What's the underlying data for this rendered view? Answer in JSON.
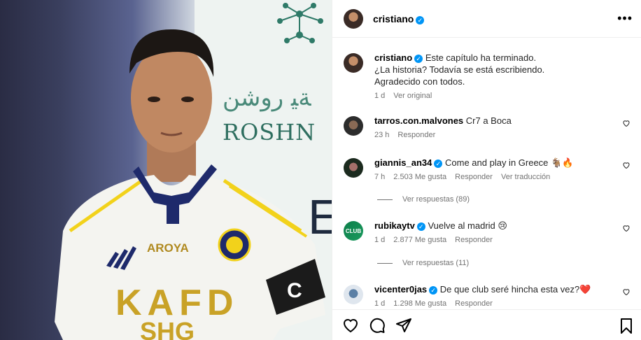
{
  "post": {
    "username": "cristiano",
    "more_icon": "more-horizontal-icon",
    "caption": {
      "username": "cristiano",
      "lines": [
        "Este capítulo ha terminado.",
        "¿La historia? Todavía se está escribiendo.",
        "Agradecido con todos."
      ],
      "time": "1 d",
      "see_original": "Ver original"
    },
    "photo": {
      "roshn_ar": "ﺔﻴ روشن",
      "roshn": "ROSHN",
      "shirt_brand": "AROYA",
      "shirt_sponsor": "KAFD",
      "shirt_bottom": "SHG"
    }
  },
  "comments": [
    {
      "user": "tarros.con.malvones",
      "verified": false,
      "text": "Cr7 a Boca",
      "time": "23 h",
      "likes": "",
      "reply": "Responder",
      "translate": ""
    },
    {
      "user": "giannis_an34",
      "verified": true,
      "text": "Come and play in Greece 🐐🔥",
      "time": "7 h",
      "likes": "2.503 Me gusta",
      "reply": "Responder",
      "translate": "Ver traducción",
      "replies": "Ver respuestas (89)"
    },
    {
      "user": "rubikaytv",
      "verified": true,
      "text": "Vuelve al madrid 😢",
      "time": "1 d",
      "likes": "2.877 Me gusta",
      "reply": "Responder",
      "translate": "",
      "replies": "Ver respuestas (11)"
    },
    {
      "user": "vicenter0jas",
      "verified": true,
      "text": "De que club seré hincha esta vez?❤️",
      "time": "1 d",
      "likes": "1.298 Me gusta",
      "reply": "Responder",
      "translate": ""
    }
  ],
  "verified_mark": "✓",
  "avatar_text_rubika": "CLUB",
  "actions": [
    "heart-icon",
    "comment-icon",
    "share-icon",
    "bookmark-icon"
  ]
}
